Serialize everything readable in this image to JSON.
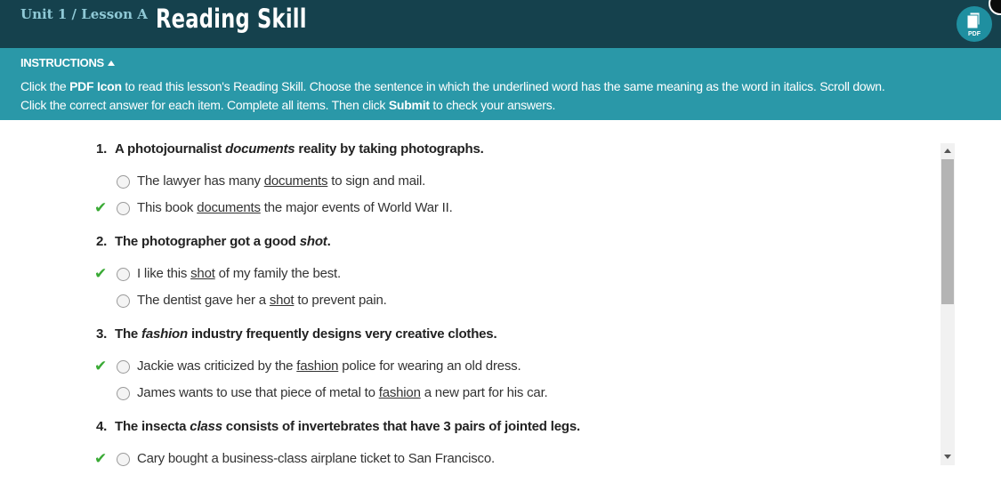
{
  "header": {
    "unit_label": "Unit 1 / Lesson A",
    "title": "Reading Skill",
    "pdf_label": "PDF"
  },
  "instructions": {
    "heading": "INSTRUCTIONS",
    "line1_pre": "Click the ",
    "line1_bold": "PDF Icon",
    "line1_post": " to read this lesson's Reading Skill. Choose the sentence in which the underlined word has the same meaning as the word in italics. Scroll down.",
    "line2_pre": "Click the correct answer for each item. Complete all items. Then click ",
    "line2_bold": "Submit",
    "line2_post": " to check your answers."
  },
  "questions": [
    {
      "num": "1.",
      "pre": "A photojournalist ",
      "italic": "documents",
      "post": " reality by taking photographs.",
      "options": [
        {
          "pre": "The lawyer has many ",
          "word": "documents",
          "post": " to sign and mail.",
          "checked": false
        },
        {
          "pre": "This book ",
          "word": "documents",
          "post": " the major events of World War II.",
          "checked": true
        }
      ]
    },
    {
      "num": "2.",
      "pre": "The photographer got a good ",
      "italic": "shot",
      "post": ".",
      "options": [
        {
          "pre": "I like this ",
          "word": "shot",
          "post": " of my family the best.",
          "checked": true
        },
        {
          "pre": "The dentist gave her a ",
          "word": "shot",
          "post": " to prevent pain.",
          "checked": false
        }
      ]
    },
    {
      "num": "3.",
      "pre": "The ",
      "italic": "fashion",
      "post": " industry frequently designs very creative clothes.",
      "options": [
        {
          "pre": "Jackie was criticized by the ",
          "word": "fashion",
          "post": " police for wearing an old dress.",
          "checked": true
        },
        {
          "pre": "James wants to use that piece of metal to ",
          "word": "fashion",
          "post": " a new part for his car.",
          "checked": false
        }
      ]
    },
    {
      "num": "4.",
      "pre": "The insecta ",
      "italic": "class",
      "post": " consists of invertebrates that have 3 pairs of jointed legs.",
      "options": [
        {
          "pre": "Cary bought a business-class airplane ticket to San Francisco.",
          "word": "",
          "post": "",
          "checked": true
        }
      ]
    }
  ],
  "check_mark": "✔",
  "colors": {
    "header_bg": "#15414d",
    "instructions_bg": "#2a98a8",
    "check_green": "#3aaa35"
  }
}
